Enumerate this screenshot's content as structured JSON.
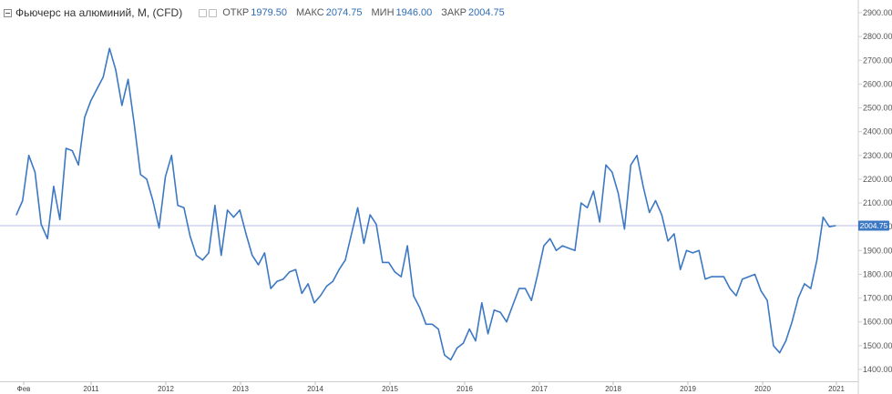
{
  "legend": {
    "title": "Фьючерс на алюминий, M, (CFD)",
    "open_label": "ОТКР",
    "open_value": "1979.50",
    "high_label": "МАКС",
    "high_value": "2074.75",
    "low_label": "МИН",
    "low_value": "1946.00",
    "close_label": "ЗАКР",
    "close_value": "2004.75"
  },
  "colors": {
    "line": "#3c78c3",
    "last_price_line": "#b8bde8",
    "last_price_badge": "#3c78c3"
  },
  "chart_data": {
    "type": "line",
    "title": "Фьючерс на алюминий, M, (CFD)",
    "ylim": [
      1400,
      2900
    ],
    "y_ticks": [
      "1400.00",
      "1500.00",
      "1600.00",
      "1700.00",
      "1800.00",
      "1900.00",
      "2000.00",
      "2100.00",
      "2200.00",
      "2300.00",
      "2400.00",
      "2500.00",
      "2600.00",
      "2700.00",
      "2800.00",
      "2900.00"
    ],
    "x_ticks": [
      "Фев",
      "2011",
      "2012",
      "2013",
      "2014",
      "2015",
      "2016",
      "2017",
      "2018",
      "2019",
      "2020",
      "2021"
    ],
    "last_price": 2004.75,
    "last_price_label": "2004.75",
    "series": [
      {
        "values": [
          2050,
          2110,
          2300,
          2230,
          2010,
          1950,
          2170,
          2030,
          2330,
          2320,
          2260,
          2460,
          2530,
          2580,
          2630,
          2750,
          2660,
          2510,
          2620,
          2430,
          2220,
          2200,
          2110,
          1995,
          2210,
          2300,
          2090,
          2080,
          1960,
          1880,
          1860,
          1890,
          2090,
          1880,
          2070,
          2040,
          2070,
          1970,
          1880,
          1840,
          1890,
          1740,
          1770,
          1780,
          1810,
          1820,
          1720,
          1760,
          1680,
          1710,
          1750,
          1770,
          1820,
          1860,
          1970,
          2080,
          1930,
          2050,
          2010,
          1850,
          1850,
          1810,
          1790,
          1920,
          1710,
          1660,
          1590,
          1590,
          1570,
          1460,
          1440,
          1490,
          1510,
          1570,
          1520,
          1680,
          1550,
          1650,
          1640,
          1600,
          1670,
          1740,
          1740,
          1690,
          1800,
          1920,
          1950,
          1900,
          1920,
          1910,
          1900,
          2100,
          2080,
          2150,
          2020,
          2260,
          2230,
          2140,
          1990,
          2260,
          2300,
          2170,
          2060,
          2110,
          2050,
          1940,
          1970,
          1820,
          1900,
          1890,
          1900,
          1780,
          1790,
          1790,
          1790,
          1740,
          1710,
          1780,
          1790,
          1800,
          1730,
          1690,
          1500,
          1470,
          1520,
          1600,
          1700,
          1760,
          1740,
          1860,
          2040,
          2000,
          2004.75
        ]
      }
    ]
  }
}
